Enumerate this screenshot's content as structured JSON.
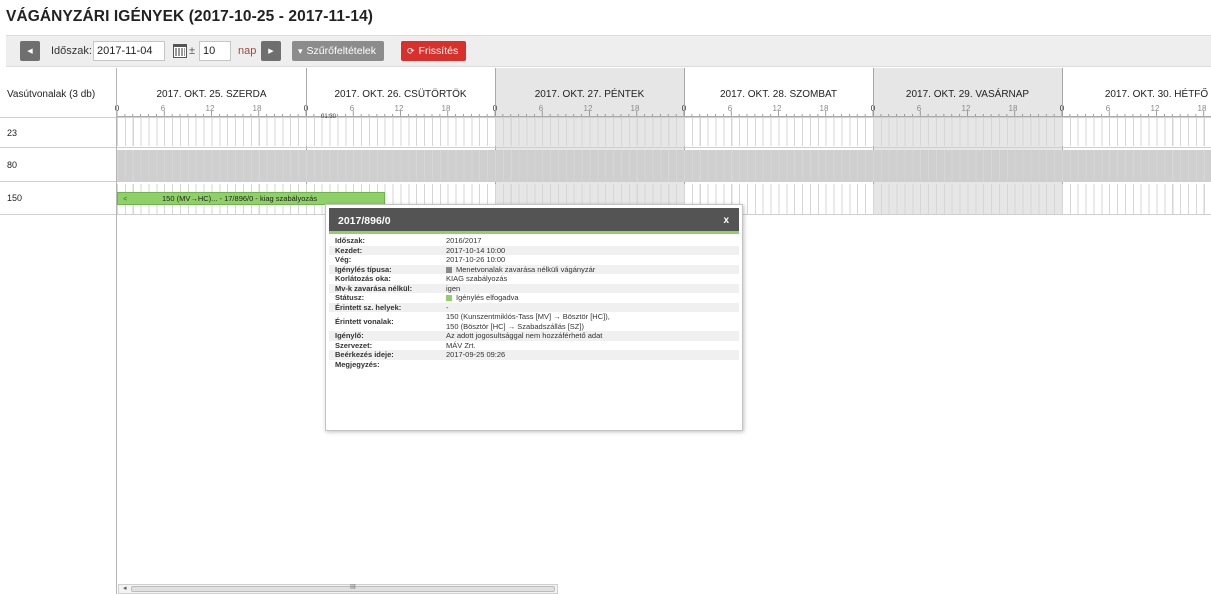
{
  "page": {
    "title": "VÁGÁNYZÁRI IGÉNYEK (2017-10-25 - 2017-11-14)"
  },
  "toolbar": {
    "prev_icon": "chevron-left-icon",
    "period_label": "Időszak:",
    "date_value": "2017-11-04",
    "calendar_icon": "calendar-icon",
    "plusminus": "±",
    "days_value": "10",
    "days_unit": "nap",
    "next_icon": "chevron-right-icon",
    "filter_icon_glyph": "▾",
    "filter_label": "Szűrőfeltételek",
    "refresh_icon_glyph": "⟳",
    "refresh_label": "Frissítés",
    "refresh_color": "#d9302b"
  },
  "gantt": {
    "lines_header": "Vasútvonalak (3 db)",
    "days": [
      {
        "label": "2017. OKT. 25. SZERDA",
        "shaded": false
      },
      {
        "label": "2017. OKT. 26. CSÜTÖRTÖK",
        "shaded": false
      },
      {
        "label": "2017. OKT. 27. PÉNTEK",
        "shaded": true
      },
      {
        "label": "2017. OKT. 28. SZOMBAT",
        "shaded": false
      },
      {
        "label": "2017. OKT. 29. VASÁRNAP",
        "shaded": true
      },
      {
        "label": "2017. OKT. 30. HÉTFŐ",
        "shaded": false
      }
    ],
    "hour_ticks": [
      "0",
      "6",
      "12",
      "18"
    ],
    "rows": [
      {
        "line": "23"
      },
      {
        "line": "80"
      },
      {
        "line": "150"
      }
    ],
    "marker_time": "01:30",
    "bar": {
      "arrow": "<",
      "text": "150 (MV→HC)... - 17/896/0 - kiag szabályozás",
      "color": "#8fd168"
    }
  },
  "popup": {
    "title": "2017/896/0",
    "close": "x",
    "rows": [
      {
        "k": "Időszak:",
        "v": "2016/2017"
      },
      {
        "k": "Kezdet:",
        "v": "2017-10-14 10:00"
      },
      {
        "k": "Vég:",
        "v": "2017-10-26 10:00"
      },
      {
        "k": "Igénylés típusa:",
        "v": "Menetvonalak zavarása nélküli vágányzár",
        "sq": "#8a8a8a"
      },
      {
        "k": "Korlátozás oka:",
        "v": "KIAG szabályozás"
      },
      {
        "k": "Mv-k zavarása nélkül:",
        "v": "igen"
      },
      {
        "k": "Státusz:",
        "v": "Igénylés elfogadva",
        "sq": "#8fd168"
      },
      {
        "k": "Érintett sz. helyek:",
        "v": "-"
      },
      {
        "k": "Érintett vonalak:",
        "v": "150 (Kunszentmiklós-Tass [MV] → Bösztör [HC]),",
        "v2": "150 (Bösztör [HC] → Szabadszállás [SZ])"
      },
      {
        "k": "Igénylő:",
        "v": "Az adott jogosultsággal nem hozzáférhető adat"
      },
      {
        "k": "Szervezet:",
        "v": "MÁV Zrt."
      },
      {
        "k": "Beérkezés ideje:",
        "v": "2017-09-25 09:26"
      },
      {
        "k": "Megjegyzés:",
        "v": ""
      }
    ]
  },
  "scrollbar": {
    "grip": "III",
    "left_icon": "scroll-left-icon"
  }
}
